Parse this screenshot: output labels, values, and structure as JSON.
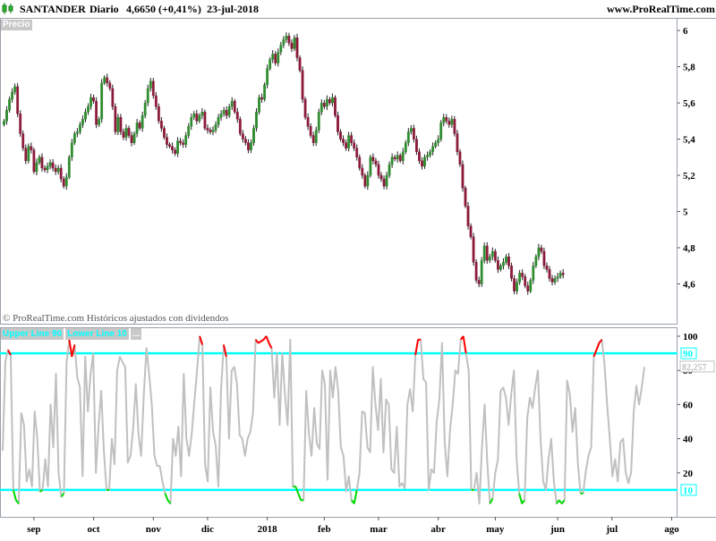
{
  "header": {
    "instrument": "SANTANDER",
    "period": "Diario",
    "last_quote": "4,6650 (+0,41%)",
    "date": "23-jul-2018",
    "site": "www.ProRealTime.com",
    "pane_tag": "Precio",
    "copyright": "© ProRealTime.com  Históricos ajustados con dividendos"
  },
  "colors": {
    "up_candle": "#2e8b2e",
    "down_candle": "#8b1a3a",
    "stoch_line": "#c0c0c0",
    "overbought_highlight": "#ff0000",
    "oversold_highlight": "#00dd00",
    "bands": "#00ffff"
  },
  "chart_data": [
    {
      "type": "candlestick",
      "title": "SANTANDER Diario",
      "ylim": [
        4.4,
        6.05
      ],
      "y_ticks": [
        "6",
        "5,8",
        "5,6",
        "5,4",
        "5,2",
        "5",
        "4,8",
        "4,6"
      ],
      "y_tick_values": [
        6.0,
        5.8,
        5.6,
        5.4,
        5.2,
        5.0,
        4.8,
        4.6
      ],
      "x_labels": [
        "sep",
        "oct",
        "nov",
        "dic",
        "2018",
        "feb",
        "mar",
        "abr",
        "may",
        "jun",
        "jul",
        "ago"
      ],
      "x_label_index": [
        11,
        33,
        55,
        75,
        97,
        118,
        138,
        160,
        181,
        204,
        224,
        246
      ],
      "close_series": [
        5.5,
        5.56,
        5.62,
        5.66,
        5.69,
        5.54,
        5.43,
        5.35,
        5.28,
        5.36,
        5.34,
        5.22,
        5.27,
        5.3,
        5.24,
        5.23,
        5.25,
        5.27,
        5.24,
        5.22,
        5.24,
        5.18,
        5.14,
        5.19,
        5.3,
        5.38,
        5.43,
        5.44,
        5.48,
        5.51,
        5.55,
        5.58,
        5.63,
        5.61,
        5.48,
        5.51,
        5.71,
        5.74,
        5.71,
        5.68,
        5.58,
        5.44,
        5.52,
        5.44,
        5.41,
        5.46,
        5.42,
        5.38,
        5.43,
        5.49,
        5.46,
        5.53,
        5.6,
        5.68,
        5.72,
        5.64,
        5.58,
        5.5,
        5.46,
        5.41,
        5.37,
        5.36,
        5.34,
        5.32,
        5.39,
        5.38,
        5.37,
        5.42,
        5.47,
        5.52,
        5.54,
        5.5,
        5.53,
        5.55,
        5.46,
        5.45,
        5.44,
        5.45,
        5.48,
        5.52,
        5.54,
        5.56,
        5.53,
        5.58,
        5.61,
        5.55,
        5.51,
        5.43,
        5.4,
        5.38,
        5.34,
        5.38,
        5.46,
        5.55,
        5.63,
        5.62,
        5.7,
        5.79,
        5.84,
        5.87,
        5.82,
        5.88,
        5.92,
        5.95,
        5.97,
        5.93,
        5.9,
        5.96,
        5.85,
        5.78,
        5.62,
        5.52,
        5.47,
        5.42,
        5.38,
        5.45,
        5.55,
        5.6,
        5.58,
        5.62,
        5.6,
        5.63,
        5.53,
        5.44,
        5.4,
        5.38,
        5.35,
        5.42,
        5.38,
        5.35,
        5.3,
        5.24,
        5.2,
        5.14,
        5.2,
        5.3,
        5.28,
        5.26,
        5.2,
        5.18,
        5.14,
        5.2,
        5.26,
        5.3,
        5.29,
        5.31,
        5.28,
        5.33,
        5.38,
        5.44,
        5.46,
        5.4,
        5.33,
        5.28,
        5.25,
        5.3,
        5.31,
        5.33,
        5.36,
        5.38,
        5.4,
        5.49,
        5.52,
        5.5,
        5.48,
        5.51,
        5.43,
        5.33,
        5.26,
        5.13,
        5.03,
        4.92,
        4.86,
        4.72,
        4.62,
        4.6,
        4.73,
        4.81,
        4.73,
        4.75,
        4.78,
        4.73,
        4.68,
        4.7,
        4.72,
        4.75,
        4.7,
        4.63,
        4.56,
        4.61,
        4.66,
        4.64,
        4.59,
        4.56,
        4.62,
        4.7,
        4.75,
        4.8,
        4.78,
        4.7,
        4.68,
        4.63,
        4.61,
        4.63,
        4.64,
        4.66,
        4.65
      ]
    },
    {
      "type": "line",
      "title": "Stochastic",
      "ylim": [
        0,
        100
      ],
      "y_ticks": [
        "100",
        "80",
        "60",
        "40",
        "20"
      ],
      "y_tick_values": [
        100,
        80,
        60,
        40,
        20
      ],
      "x_labels": [
        "sep",
        "oct",
        "nov",
        "dic",
        "2018",
        "feb",
        "mar",
        "abr",
        "may",
        "jun",
        "jul",
        "ago"
      ],
      "legend": [
        "Upper Line 90",
        "Lower Line 10",
        "..."
      ],
      "levels": [
        {
          "name": "Upper Line 90",
          "value": 90,
          "label": "90"
        },
        {
          "name": "Lower Line 10",
          "value": 10,
          "label": "10"
        }
      ],
      "last_value": 82.257,
      "last_value_label": "82,257",
      "values": [
        33,
        85,
        92,
        89,
        10,
        4,
        2,
        55,
        48,
        15,
        22,
        12,
        56,
        40,
        9,
        10,
        28,
        12,
        60,
        35,
        78,
        20,
        6,
        8,
        85,
        98,
        88,
        95,
        76,
        70,
        18,
        88,
        56,
        78,
        90,
        20,
        47,
        68,
        33,
        10,
        10,
        40,
        25,
        80,
        88,
        85,
        82,
        26,
        30,
        46,
        72,
        43,
        30,
        66,
        93,
        78,
        60,
        30,
        24,
        24,
        15,
        8,
        4,
        2,
        40,
        30,
        47,
        18,
        78,
        40,
        30,
        43,
        62,
        80,
        100,
        95,
        25,
        15,
        70,
        44,
        36,
        12,
        68,
        95,
        88,
        40,
        80,
        82,
        72,
        42,
        40,
        30,
        40,
        44,
        55,
        98,
        96,
        97,
        98,
        100,
        96,
        93,
        64,
        90,
        48,
        90,
        66,
        48,
        98,
        12,
        12,
        8,
        4,
        4,
        68,
        43,
        30,
        58,
        37,
        34,
        80,
        72,
        16,
        80,
        64,
        82,
        68,
        35,
        30,
        9,
        18,
        4,
        2,
        10,
        20,
        56,
        55,
        35,
        32,
        82,
        60,
        45,
        75,
        32,
        63,
        60,
        22,
        20,
        47,
        12,
        14,
        11,
        60,
        69,
        56,
        89,
        98,
        98,
        75,
        73,
        10,
        22,
        20,
        50,
        63,
        96,
        38,
        18,
        45,
        60,
        80,
        78,
        98,
        100,
        90,
        80,
        10,
        10,
        20,
        2,
        35,
        60,
        26,
        2,
        5,
        20,
        28,
        68,
        70,
        64,
        48,
        66,
        80,
        28,
        8,
        2,
        4,
        52,
        64,
        58,
        70,
        80,
        40,
        15,
        10,
        28,
        40,
        15,
        2,
        4,
        2,
        4,
        74,
        66,
        44,
        58,
        26,
        8,
        8,
        21,
        30,
        35,
        88,
        92,
        96,
        98,
        84,
        60,
        40,
        18,
        28,
        15,
        38,
        40,
        20,
        14,
        20,
        56,
        71,
        60,
        70,
        82
      ]
    }
  ]
}
